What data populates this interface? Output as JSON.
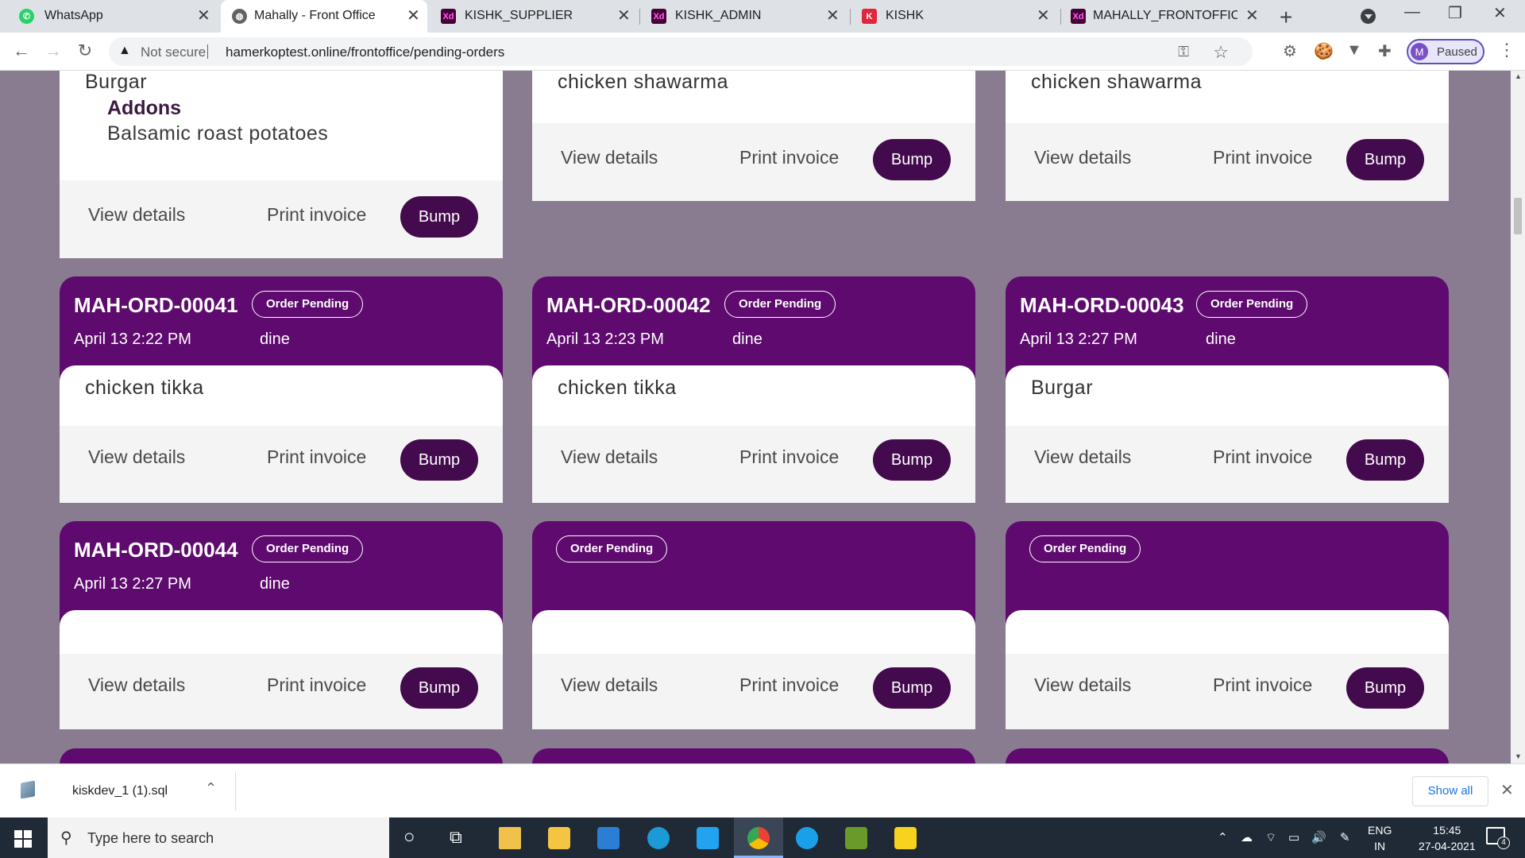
{
  "browser": {
    "tabs": [
      {
        "title": "WhatsApp",
        "icon": "whatsapp-icon",
        "color": "#25d366",
        "glyph": "✆"
      },
      {
        "title": "Mahally - Front Office",
        "icon": "globe-icon",
        "color": "#5f6368",
        "glyph": "◍"
      },
      {
        "title": "KISHK_SUPPLIER",
        "icon": "adobe-xd-icon",
        "color": "#470137",
        "glyph": "Xd"
      },
      {
        "title": "KISHK_ADMIN",
        "icon": "adobe-xd-icon",
        "color": "#470137",
        "glyph": "Xd"
      },
      {
        "title": "KISHK",
        "icon": "kishk-icon",
        "color": "#e0263a",
        "glyph": "K"
      },
      {
        "title": "MAHALLY_FRONTOFFICEW",
        "icon": "adobe-xd-icon",
        "color": "#470137",
        "glyph": "Xd"
      }
    ],
    "close_glyph": "✕",
    "new_tab_glyph": "+",
    "window_controls": {
      "minimize": "—",
      "maximize": "❐",
      "close": "✕"
    },
    "nav": {
      "back": "←",
      "forward": "→",
      "reload": "↻"
    },
    "security_icon": "▲",
    "security_text": "Not secure",
    "url": "hamerkoptest.online/frontoffice/pending-orders",
    "key_glyph": "⚿",
    "star_glyph": "☆",
    "extensions": [
      "⚙",
      "🍪",
      "▼",
      "✚"
    ],
    "profile": {
      "initial": "M",
      "status": "Paused"
    },
    "menu_glyph": "⋮"
  },
  "orders_top_row": [
    {
      "item": "Burgar",
      "addons_label": "Addons",
      "addon": "Balsamic roast potatoes"
    },
    {
      "item": "chicken shawarma"
    },
    {
      "item": "chicken shawarma"
    }
  ],
  "orders": [
    {
      "number": "MAH-ORD-00041",
      "status": "Order Pending",
      "date": "April 13 2:22 PM",
      "mode": "dine",
      "item": "chicken tikka"
    },
    {
      "number": "MAH-ORD-00042",
      "status": "Order Pending",
      "date": "April 13 2:23 PM",
      "mode": "dine",
      "item": "chicken tikka"
    },
    {
      "number": "MAH-ORD-00043",
      "status": "Order Pending",
      "date": "April 13 2:27 PM",
      "mode": "dine",
      "item": "Burgar"
    },
    {
      "number": "MAH-ORD-00044",
      "status": "Order Pending",
      "date": "April 13 2:27 PM",
      "mode": "dine",
      "item": ""
    },
    {
      "number": "",
      "status": "Order Pending",
      "date": "",
      "mode": "",
      "item": ""
    },
    {
      "number": "",
      "status": "Order Pending",
      "date": "",
      "mode": "",
      "item": ""
    }
  ],
  "actions": {
    "view_details": "View details",
    "print_invoice": "Print invoice",
    "bump": "Bump"
  },
  "colors": {
    "header_purple": "#5e0a6e",
    "bump_purple": "#430a4d",
    "page_bg": "#8a7c90"
  },
  "download_shelf": {
    "file": "kiskdev_1 (1).sql",
    "chevron": "⌃",
    "show_all": "Show all",
    "close": "✕"
  },
  "taskbar": {
    "search_placeholder": "Type here to search",
    "search_glyph": "⚲",
    "cortana_glyph": "○",
    "task_view_glyph": "⧉",
    "tray_glyphs": [
      "⌃",
      "☁",
      "⌔",
      "▭",
      "🔊",
      "✎"
    ],
    "language": "ENG",
    "region": "IN",
    "time": "15:45",
    "date": "27-04-2021",
    "notifications": "4"
  }
}
